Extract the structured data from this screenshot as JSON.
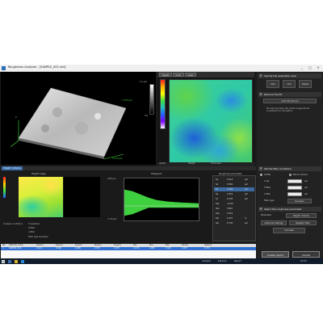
{
  "window": {
    "title": "Roughness Analyzer - [SAMPLE_001.vk4]",
    "controls": [
      "_",
      "□",
      "×"
    ]
  },
  "view3d": {
    "colorbar_top": "1.0 µm",
    "colorbar_bottom": "0.0",
    "axis_x": "X 272 µm",
    "axis_y": "Y 272 µm",
    "axis_z": "Z"
  },
  "view2d": {
    "toolbar": [
      "Height",
      "Color",
      "Laser"
    ],
    "status_left": "3D/2D",
    "status_mid": "Height",
    "status_right": "Thickness"
  },
  "right_panel": {
    "step1": {
      "num": "1",
      "title": "Specify the evaluation area",
      "buttons": [
        "Auto",
        "Add",
        "Delete"
      ]
    },
    "step2": {
      "num": "2",
      "title": "Remove the tilt",
      "checkbox": "Auto tilt removal",
      "note": "No area has been set, entire image will be considered for calculation"
    },
    "step3": {
      "num": "3",
      "title": "Set the filter conditions",
      "radio1": "S-filter",
      "radio2": "Not to remove",
      "filter1": "λ s(f)",
      "filter2": "F filter",
      "filter3": "L filter",
      "unit": "µm",
      "filter_type_label": "Filter type",
      "filter_type": "Gaussian"
    },
    "step4": {
      "num": "4",
      "title": "Select the roughness parameter",
      "param_label": "Parameter",
      "param_value": "Height / Volume",
      "adv": "Advanced settings",
      "reg": "Register table",
      "calc": "Calculate"
    },
    "actions": {
      "create": "Create report",
      "cancel": "Cancel"
    }
  },
  "bottom": {
    "tab": "Height / Volume",
    "height_image_title": "Height image",
    "histogram_title": "Histogram",
    "histo_y_top": "2.65 µm",
    "histo_y_bottom": "-1.30 µm",
    "params_title": "Roughness parameter",
    "params": [
      {
        "name": "Sa",
        "value": "0.414",
        "unit": "µm"
      },
      {
        "name": "Sq",
        "value": "0.560",
        "unit": "µm"
      },
      {
        "name": "Sz",
        "value": "4.286",
        "unit": "µm"
      },
      {
        "name": "Sp",
        "value": "2.051",
        "unit": "µm"
      },
      {
        "name": "Sv",
        "value": "2.235",
        "unit": "µm"
      },
      {
        "name": "Ssk",
        "value": "-0.313",
        "unit": ""
      },
      {
        "name": "Sku",
        "value": "3.867",
        "unit": ""
      },
      {
        "name": "Sdq",
        "value": "0.310",
        "unit": ""
      },
      {
        "name": "Sdr",
        "value": "4.437",
        "unit": "%"
      },
      {
        "name": "Sal",
        "value": "8.745",
        "unit": "µm"
      }
    ],
    "analysis_label": "Analysis conditions",
    "options": [
      "F-operation",
      "S-filter",
      "L-filter"
    ],
    "options_footer": "Filter type        Gaussian"
  },
  "results_table": {
    "headers": [
      "No.",
      "Data file name",
      "Sa(µm)",
      "Sq(µm)",
      "Sz(µm)",
      "Sp(µm)",
      "Sv(µm)",
      "Ssk",
      "Sku",
      "Sdq",
      "Sdr(%)",
      "Sal(µm)"
    ],
    "row": [
      "1",
      "SAMPLE_001",
      "0.414",
      "0.560",
      "4.286",
      "2.051",
      "2.235",
      "-0.313",
      "3.867",
      "0.310",
      "4.437",
      "8.745"
    ]
  },
  "taskbar": {
    "items": [
      "Analyzer",
      "Explorer",
      "Report"
    ],
    "time": "10:24",
    "date": "2019/05/21"
  },
  "colors": {
    "background": "#1b1b1b",
    "accent": "#3a6ea8",
    "selection": "#2f6fd0"
  }
}
